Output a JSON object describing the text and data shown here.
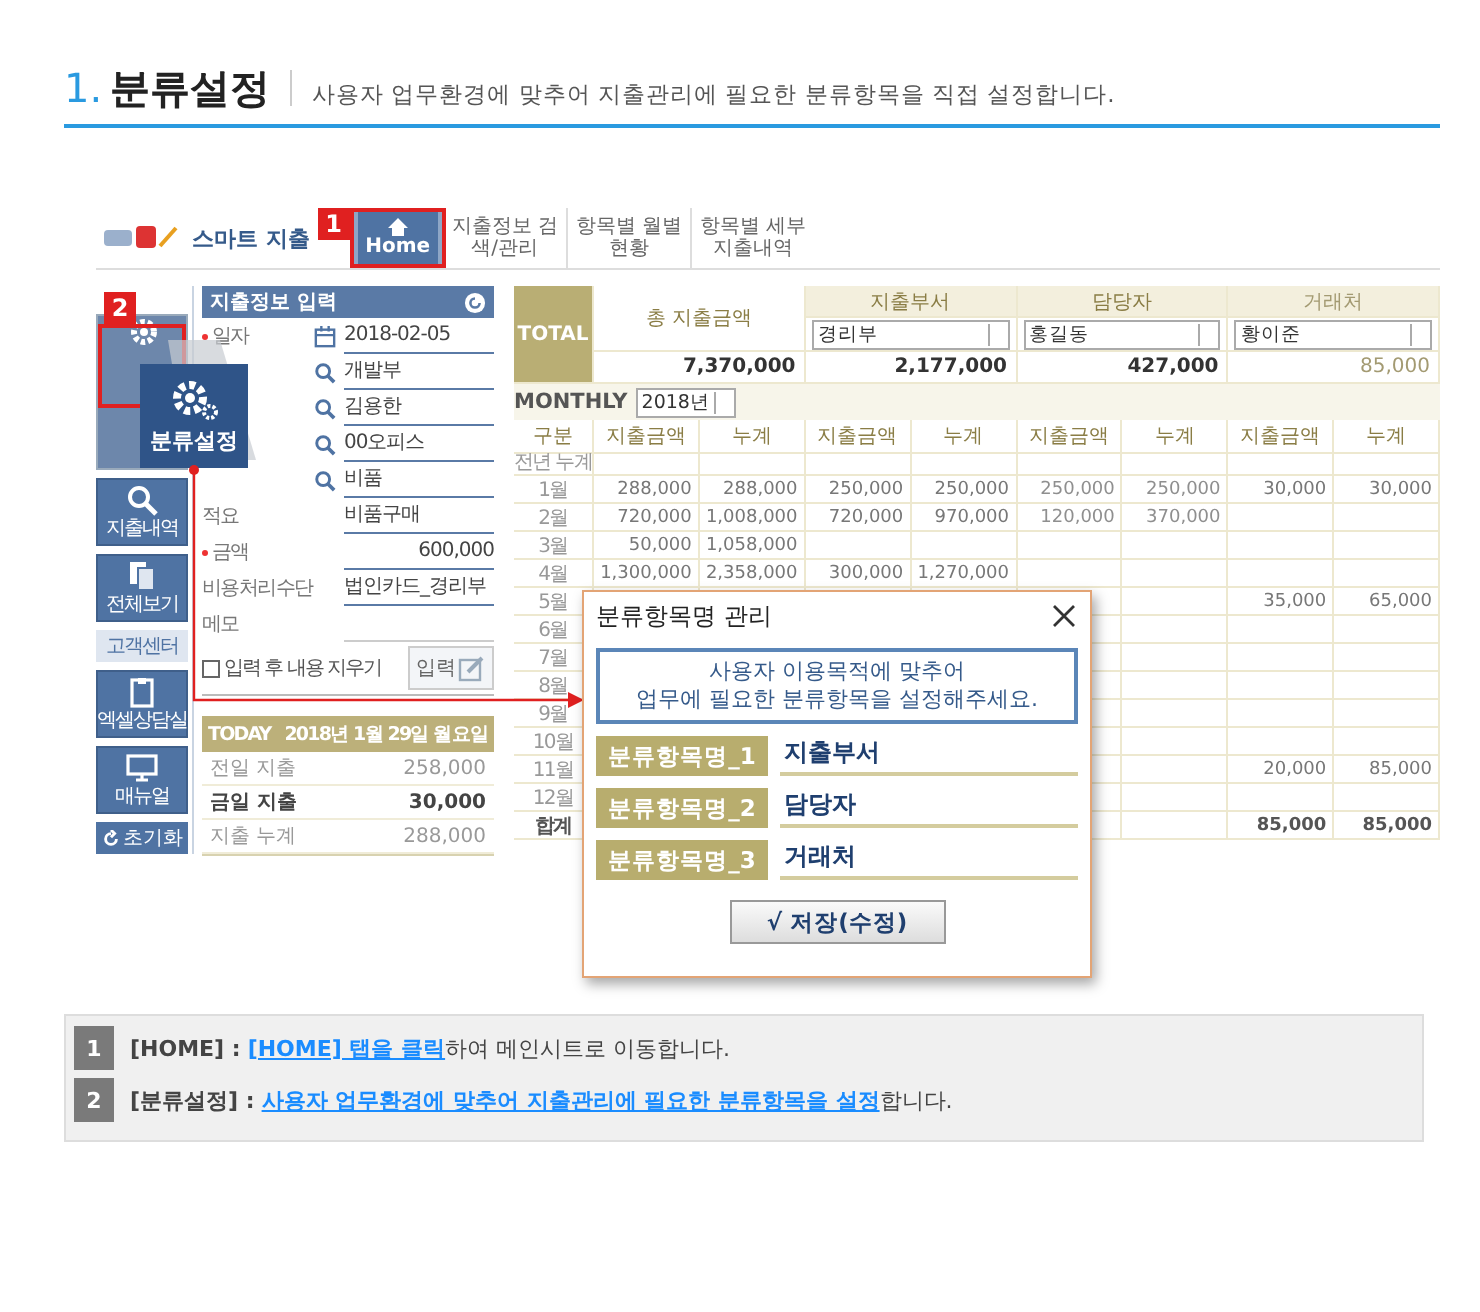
{
  "header": {
    "number": "1.",
    "title": "분류설정",
    "description": "사용자 업무환경에 맞추어 지출관리에 필요한 분류항목을 직접 설정합니다."
  },
  "app": {
    "brand": "스마트 지출",
    "nav_tabs": [
      {
        "label": "Home",
        "selected": true
      },
      {
        "label": "지출정보 검색/관리",
        "selected": false
      },
      {
        "label": "항목별 월별현황",
        "selected": false
      },
      {
        "label": "항목별 세부 지출내역",
        "selected": false
      }
    ],
    "callouts": [
      "1",
      "2"
    ],
    "sidebar": [
      {
        "kind": "button",
        "selected": true
      },
      {
        "kind": "button",
        "label": "지출내역",
        "selected": false
      },
      {
        "kind": "button",
        "label": "전체보기",
        "selected": false
      },
      {
        "kind": "section",
        "label": "고객센터"
      },
      {
        "kind": "button",
        "label": "엑셀상담실",
        "selected": false
      },
      {
        "kind": "button",
        "label": "매뉴얼",
        "selected": false
      },
      {
        "kind": "small",
        "label": "초기화"
      }
    ],
    "magnifier": {
      "label": "분류설정"
    },
    "form": {
      "title": "지출정보 입력",
      "rows": [
        {
          "kind": "date",
          "label": "일자",
          "required": true,
          "value": "2018-02-05"
        },
        {
          "kind": "search",
          "required": false,
          "value": "개발부"
        },
        {
          "kind": "search",
          "required": false,
          "value": "김용한"
        },
        {
          "kind": "search",
          "required": false,
          "value": "00오피스"
        },
        {
          "kind": "search",
          "required": false,
          "value": "비품"
        },
        {
          "kind": "text",
          "label": "적요",
          "required": false,
          "value": "비품구매"
        },
        {
          "kind": "amount",
          "label": "금액",
          "required": true,
          "value": "600,000"
        },
        {
          "kind": "text",
          "label": "비용처리수단",
          "required": false,
          "value": "법인카드_경리부"
        },
        {
          "kind": "text",
          "label": "메모",
          "required": false
        }
      ],
      "clear_after_input": {
        "label": "입력 후 내용 지우기",
        "checked": false
      },
      "submit": "입력"
    },
    "today": {
      "title": "TODAY",
      "date": "2018년 1월 29일 월요일",
      "rows": [
        {
          "label": "전일 지출",
          "value": "258,000",
          "bold": false
        },
        {
          "label": "금일 지출",
          "value": "30,000",
          "bold": true
        },
        {
          "label": "지출 누계",
          "value": "288,000",
          "bold": false
        }
      ]
    },
    "summary": {
      "total_label": "TOTAL",
      "total_title": "총 지출금액",
      "total": "7,370,000",
      "groups": [
        {
          "title": "지출부서",
          "select": "경리부",
          "amount": "2,177,000",
          "faded": false
        },
        {
          "title": "담당자",
          "select": "홍길동",
          "amount": "427,000",
          "faded": false
        },
        {
          "title": "거래처",
          "select": "황이준",
          "amount": "85,000",
          "faded": true
        }
      ]
    },
    "monthly": {
      "label": "MONTHLY",
      "year": "2018년",
      "columns": [
        "구분",
        "지출금액",
        "누계",
        "지출금액",
        "누계",
        "지출금액",
        "누계",
        "지출금액",
        "누계"
      ],
      "rows": [
        {
          "kind": "month",
          "cells": [
            "전년 누계",
            "",
            "",
            "",
            "",
            "",
            "",
            "",
            ""
          ]
        },
        {
          "kind": "month",
          "cells": [
            "1월",
            "288,000",
            "288,000",
            "250,000",
            "250,000",
            "250,000",
            "250,000",
            "30,000",
            "30,000"
          ]
        },
        {
          "kind": "month",
          "cells": [
            "2월",
            "720,000",
            "1,008,000",
            "720,000",
            "970,000",
            "120,000",
            "370,000",
            "",
            ""
          ]
        },
        {
          "kind": "month",
          "cells": [
            "3월",
            "50,000",
            "1,058,000",
            "",
            "",
            "",
            "",
            "",
            ""
          ]
        },
        {
          "kind": "month",
          "cells": [
            "4월",
            "1,300,000",
            "2,358,000",
            "300,000",
            "1,270,000",
            "",
            "",
            "",
            ""
          ]
        },
        {
          "kind": "month",
          "cells": [
            "5월",
            "",
            "",
            "",
            "",
            "",
            "",
            "35,000",
            "65,000"
          ]
        },
        {
          "kind": "month",
          "cells": [
            "6월",
            "",
            "",
            "",
            "",
            "",
            "",
            "",
            ""
          ]
        },
        {
          "kind": "month",
          "cells": [
            "7월",
            "",
            "",
            "",
            "",
            "",
            "",
            "",
            ""
          ]
        },
        {
          "kind": "month",
          "cells": [
            "8월",
            "",
            "",
            "",
            "",
            "",
            "",
            "",
            ""
          ]
        },
        {
          "kind": "month",
          "cells": [
            "9월",
            "",
            "",
            "",
            "",
            "",
            "",
            "",
            ""
          ]
        },
        {
          "kind": "month",
          "cells": [
            "10월",
            "",
            "",
            "",
            "",
            "",
            "",
            "",
            ""
          ]
        },
        {
          "kind": "month",
          "cells": [
            "11월",
            "",
            "",
            "",
            "",
            "",
            "",
            "20,000",
            "85,000"
          ]
        },
        {
          "kind": "month",
          "cells": [
            "12월",
            "",
            "",
            "",
            "",
            "",
            "",
            "",
            ""
          ]
        },
        {
          "kind": "total",
          "cells": [
            "합계",
            "",
            "",
            "",
            "",
            "",
            "",
            "85,000",
            "85,000"
          ]
        }
      ]
    },
    "dialog": {
      "title": "분류항목명 관리",
      "notice": [
        "사용자 이용목적에 맞추어",
        "업무에 필요한 분류항목을 설정해주세요."
      ],
      "fields": [
        {
          "label": "분류항목명_1",
          "value": "지출부서"
        },
        {
          "label": "분류항목명_2",
          "value": "담당자"
        },
        {
          "label": "분류항목명_3",
          "value": "거래처"
        }
      ],
      "save": "√ 저장(수정)"
    }
  },
  "instructions": [
    {
      "number": "1",
      "lead": "**[HOME] :** ",
      "link": "[HOME] 탭을 클릭",
      "rest": "하여 메인시트로 이동합니다."
    },
    {
      "number": "2",
      "lead": "**[분류설정] :** ",
      "link": "사용자 업무환경에 맞추어 지출관리에 필요한 분류항목을 설정",
      "rest": "합니다."
    }
  ]
}
